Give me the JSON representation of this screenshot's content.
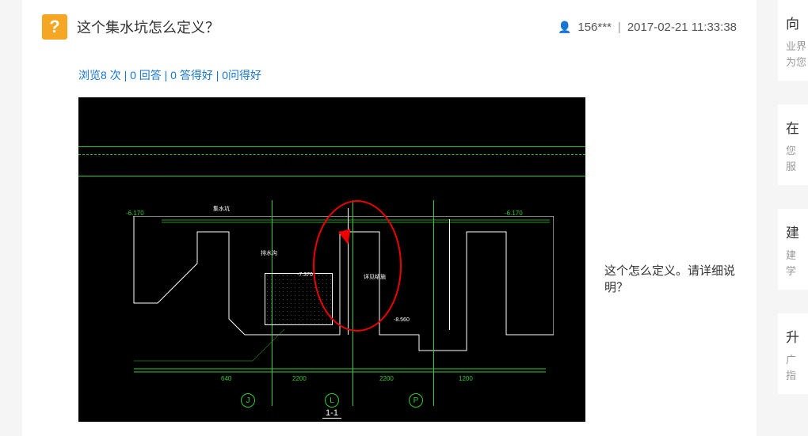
{
  "question": {
    "icon_glyph": "?",
    "title": "这个集水坑怎么定义？",
    "user_label": "156***",
    "timestamp": "2017-02-21 11:33:38",
    "stats": "浏览8 次 | 0 回答 | 0 答得好 | 0问得好",
    "body_text": "这个怎么定义。请详细说明？"
  },
  "cad": {
    "grid_labels": [
      "J",
      "L",
      "P"
    ],
    "section_label": "1-1",
    "dims_bottom": [
      "640",
      "2200",
      "2200",
      "1200"
    ],
    "elev_left": "-6.170",
    "elev_right": "-6.170",
    "label_mid1": "集水坑",
    "label_mid2": "排水沟",
    "label_mid3": "详见结施",
    "level1": "-7.370",
    "level2": "-8.560"
  },
  "sidebar": {
    "items": [
      {
        "title": "向",
        "desc1": "业界",
        "desc2": "为您"
      },
      {
        "title": "在",
        "desc1": "您",
        "desc2": "服"
      },
      {
        "title": "建",
        "desc1": "建",
        "desc2": "学"
      },
      {
        "title": "升",
        "desc1": "广",
        "desc2": "指"
      }
    ]
  }
}
